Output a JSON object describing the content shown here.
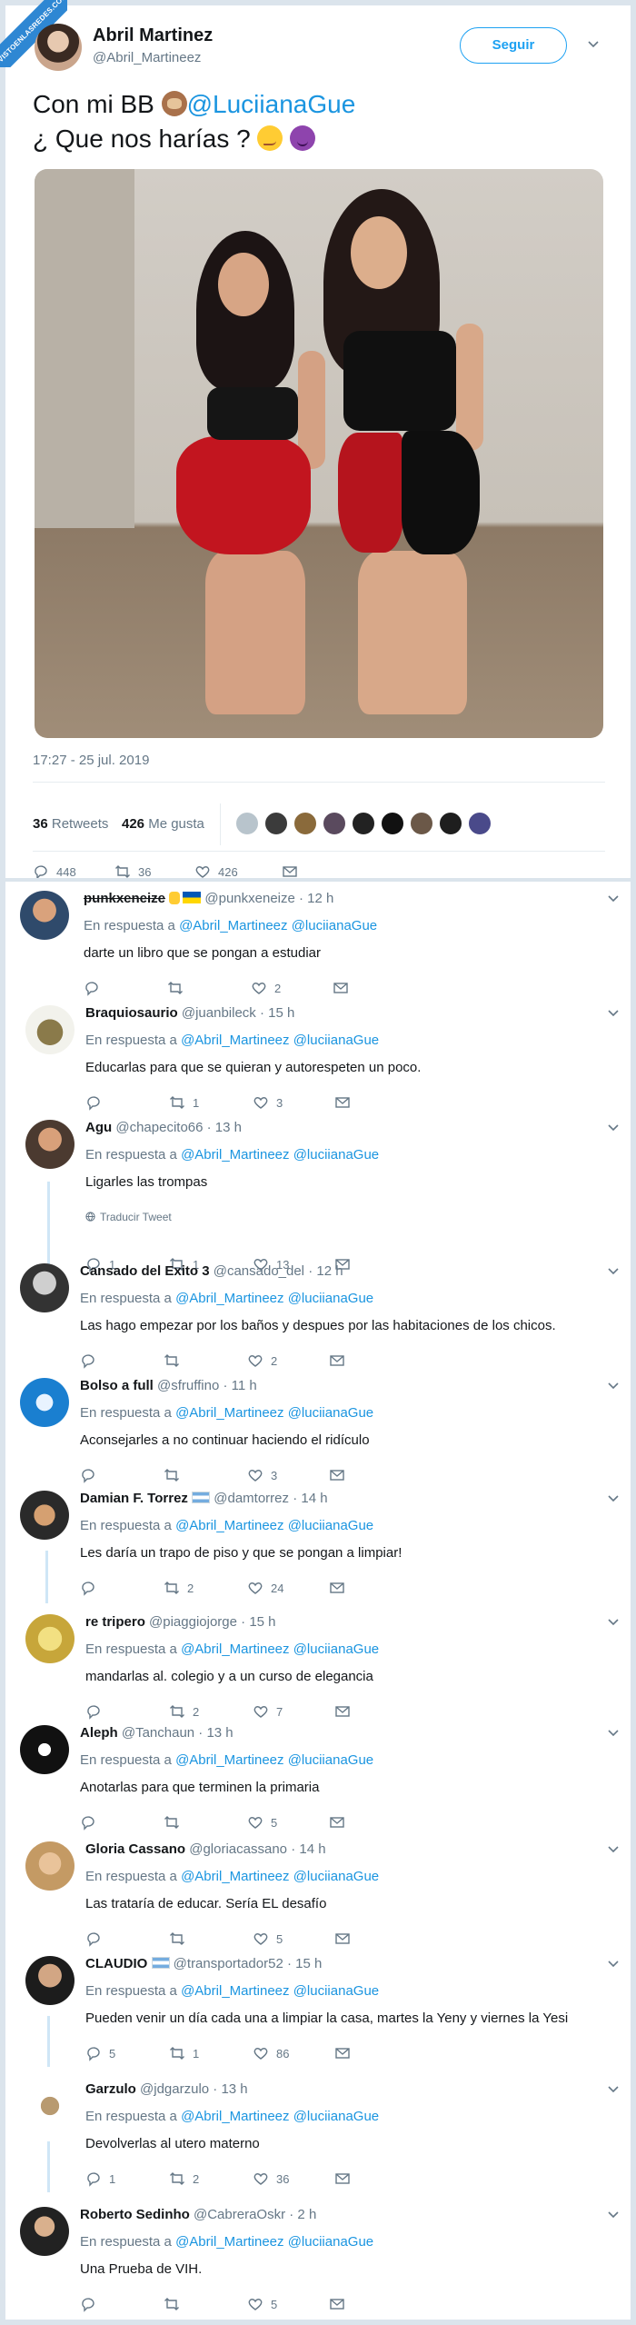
{
  "watermark": "VISTOENLASREDES.COM",
  "main_tweet": {
    "name": "Abril Martinez",
    "handle": "@Abril_Martineez",
    "follow_label": "Seguir",
    "text_line1_prefix": "Con mi BB",
    "text_line1_mention": "@LuciianaGue",
    "text_line2": "¿ Que nos harías ?",
    "timestamp": "17:27 - 25 jul. 2019",
    "retweets_count": "36",
    "retweets_label": "Retweets",
    "likes_count": "426",
    "likes_label": "Me gusta",
    "reply_count": "448",
    "retweet_action_count": "36",
    "like_action_count": "426"
  },
  "replies": [
    {
      "name": "punkxeneize",
      "handle": "@punkxeneize",
      "time": "· 12 h",
      "resp_prefix": "En respuesta a",
      "resp_m1": "@Abril_Martineez",
      "resp_m2": "@luciianaGue",
      "text": "darte un libro que se pongan a estudiar",
      "replies": "",
      "retweets": "",
      "likes": "2"
    },
    {
      "name": "Braquiosaurio",
      "handle": "@juanbileck",
      "time": "· 15 h",
      "resp_prefix": "En respuesta a",
      "resp_m1": "@Abril_Martineez",
      "resp_m2": "@luciianaGue",
      "text": "Educarlas para que se quieran y autorespeten un poco.",
      "replies": "",
      "retweets": "1",
      "likes": "3"
    },
    {
      "name": "Agu",
      "handle": "@chapecito66",
      "time": "· 13 h",
      "resp_prefix": "En respuesta a",
      "resp_m1": "@Abril_Martineez",
      "resp_m2": "@luciianaGue",
      "text": "Ligarles las trompas",
      "translate": "Traducir Tweet",
      "replies": "1",
      "retweets": "1",
      "likes": "13"
    },
    {
      "name": "Cansado del Exito 3",
      "handle": "@cansado_del",
      "time": "· 12 h",
      "resp_prefix": "En respuesta a",
      "resp_m1": "@Abril_Martineez",
      "resp_m2": "@luciianaGue",
      "text": "Las hago empezar por los baños y despues por las habitaciones de los chicos.",
      "replies": "",
      "retweets": "",
      "likes": "2"
    },
    {
      "name": "Bolso a full",
      "handle": "@sfruffino",
      "time": "· 11 h",
      "resp_prefix": "En respuesta a",
      "resp_m1": "@Abril_Martineez",
      "resp_m2": "@luciianaGue",
      "text": "Aconsejarles a no continuar haciendo el ridículo",
      "replies": "",
      "retweets": "",
      "likes": "3"
    },
    {
      "name": "Damian F. Torrez",
      "handle": "@damtorrez",
      "time": "· 14 h",
      "resp_prefix": "En respuesta a",
      "resp_m1": "@Abril_Martineez",
      "resp_m2": "@luciianaGue",
      "text": "Les daría un trapo de piso y que se pongan a limpiar!",
      "replies": "",
      "retweets": "2",
      "likes": "24"
    },
    {
      "name": "re tripero",
      "handle": "@piaggiojorge",
      "time": "· 15 h",
      "resp_prefix": "En respuesta a",
      "resp_m1": "@Abril_Martineez",
      "resp_m2": "@luciianaGue",
      "text": "mandarlas al. colegio y a un curso de elegancia",
      "replies": "",
      "retweets": "2",
      "likes": "7"
    },
    {
      "name": "Aleph",
      "handle": "@Tanchaun",
      "time": "· 13 h",
      "resp_prefix": "En respuesta a",
      "resp_m1": "@Abril_Martineez",
      "resp_m2": "@luciianaGue",
      "text": "Anotarlas para que terminen la primaria",
      "replies": "",
      "retweets": "",
      "likes": "5"
    },
    {
      "name": "Gloria Cassano",
      "handle": "@gloriacassano",
      "time": "· 14 h",
      "resp_prefix": "En respuesta a",
      "resp_m1": "@Abril_Martineez",
      "resp_m2": "@luciianaGue",
      "text": "Las trataría de educar. Sería EL desafío",
      "replies": "",
      "retweets": "",
      "likes": "5"
    },
    {
      "name": "CLAUDIO",
      "handle": "@transportador52",
      "time": "· 15 h",
      "resp_prefix": "En respuesta a",
      "resp_m1": "@Abril_Martineez",
      "resp_m2": "@luciianaGue",
      "text": "Pueden venir un día cada una a limpiar la casa, martes la Yeny y viernes la Yesi",
      "replies": "5",
      "retweets": "1",
      "likes": "86"
    },
    {
      "name": "Garzulo",
      "handle": "@jdgarzulo",
      "time": "· 13 h",
      "resp_prefix": "En respuesta a",
      "resp_m1": "@Abril_Martineez",
      "resp_m2": "@luciianaGue",
      "text": "Devolverlas al utero materno",
      "replies": "1",
      "retweets": "2",
      "likes": "36"
    },
    {
      "name": "Roberto Sedinho",
      "handle": "@CabreraOskr",
      "time": "· 2 h",
      "resp_prefix": "En respuesta a",
      "resp_m1": "@Abril_Martineez",
      "resp_m2": "@luciianaGue",
      "text": "Una Prueba de VIH.",
      "replies": "",
      "retweets": "",
      "likes": "5"
    }
  ],
  "icons": [
    "reply-icon",
    "retweet-icon",
    "like-icon",
    "message-icon",
    "chevron-down-icon",
    "globe-icon"
  ],
  "colors": {
    "accent": "#1da1f2",
    "mention": "#1b95e0",
    "secondary_text": "#657786",
    "frame": "#dbe4ec"
  }
}
